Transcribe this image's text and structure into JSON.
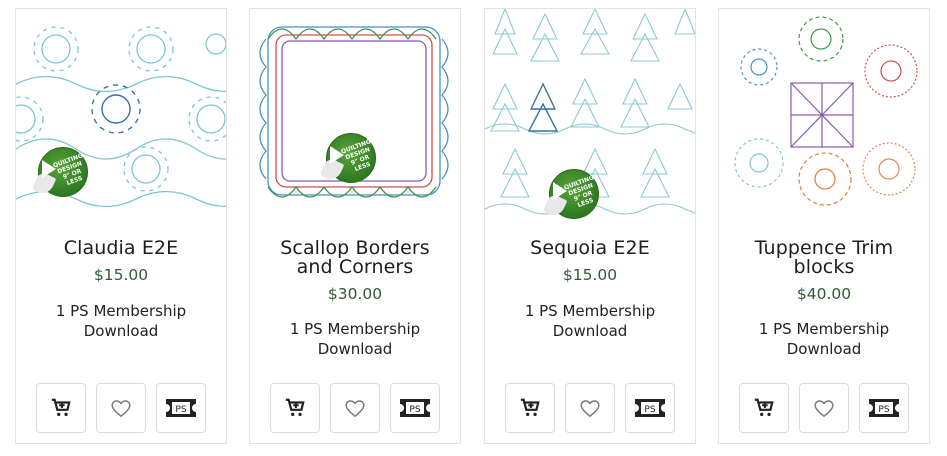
{
  "badge_text": [
    "QUILTING",
    "DESIGN",
    "9\" OR",
    "LESS"
  ],
  "colors": {
    "price": "#2f5b33",
    "border": "#e2e2e2",
    "badge_green": "#3f8f2c"
  },
  "products": [
    {
      "title": "Claudia E2E",
      "price": "$15.00",
      "membership_line1": "1 PS Membership",
      "membership_line2": "Download",
      "has_badge": true,
      "image": "claudia-pattern"
    },
    {
      "title_line1": "Scallop Borders",
      "title_line2": "and Corners",
      "price": "$30.00",
      "membership_line1": "1 PS Membership",
      "membership_line2": "Download",
      "has_badge": true,
      "image": "scallop-pattern"
    },
    {
      "title": "Sequoia E2E",
      "price": "$15.00",
      "membership_line1": "1 PS Membership",
      "membership_line2": "Download",
      "has_badge": true,
      "image": "sequoia-pattern"
    },
    {
      "title_line1": "Tuppence Trim",
      "title_line2": "blocks",
      "price": "$40.00",
      "membership_line1": "1 PS Membership",
      "membership_line2": "Download",
      "has_badge": false,
      "image": "tuppence-pattern"
    }
  ],
  "buttons": {
    "cart_icon": "add-to-cart-icon",
    "wish_icon": "heart-icon",
    "ps_icon": "ps-ticket-icon",
    "ps_label": "PS"
  }
}
